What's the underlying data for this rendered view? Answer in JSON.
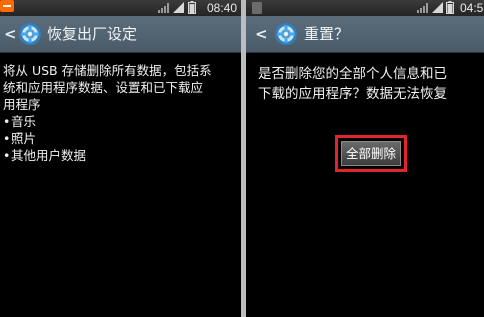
{
  "left_screen": {
    "status": {
      "time": "08:40"
    },
    "header": {
      "back": "<",
      "title": "恢复出厂设定",
      "icon": "gear-icon"
    },
    "body": {
      "lines": [
        "将从 USB 存储删除所有数据，包括系",
        "统和应用程序数据、设置和已下载应",
        "用程序"
      ],
      "items": [
        "音乐",
        "照片",
        "其他用户数据"
      ]
    }
  },
  "right_screen": {
    "status": {
      "time": "04:58"
    },
    "header": {
      "back": "<",
      "title": "重置？",
      "icon": "gear-icon"
    },
    "body": {
      "lines": [
        "是否删除您的全部个人信息和已",
        "下载的应用程序？数据无法恢复"
      ],
      "delete_all_label": "全部删除"
    }
  },
  "colors": {
    "title_bar": "#556674",
    "highlight": "#e0262c",
    "gear": "#4aa3df"
  }
}
